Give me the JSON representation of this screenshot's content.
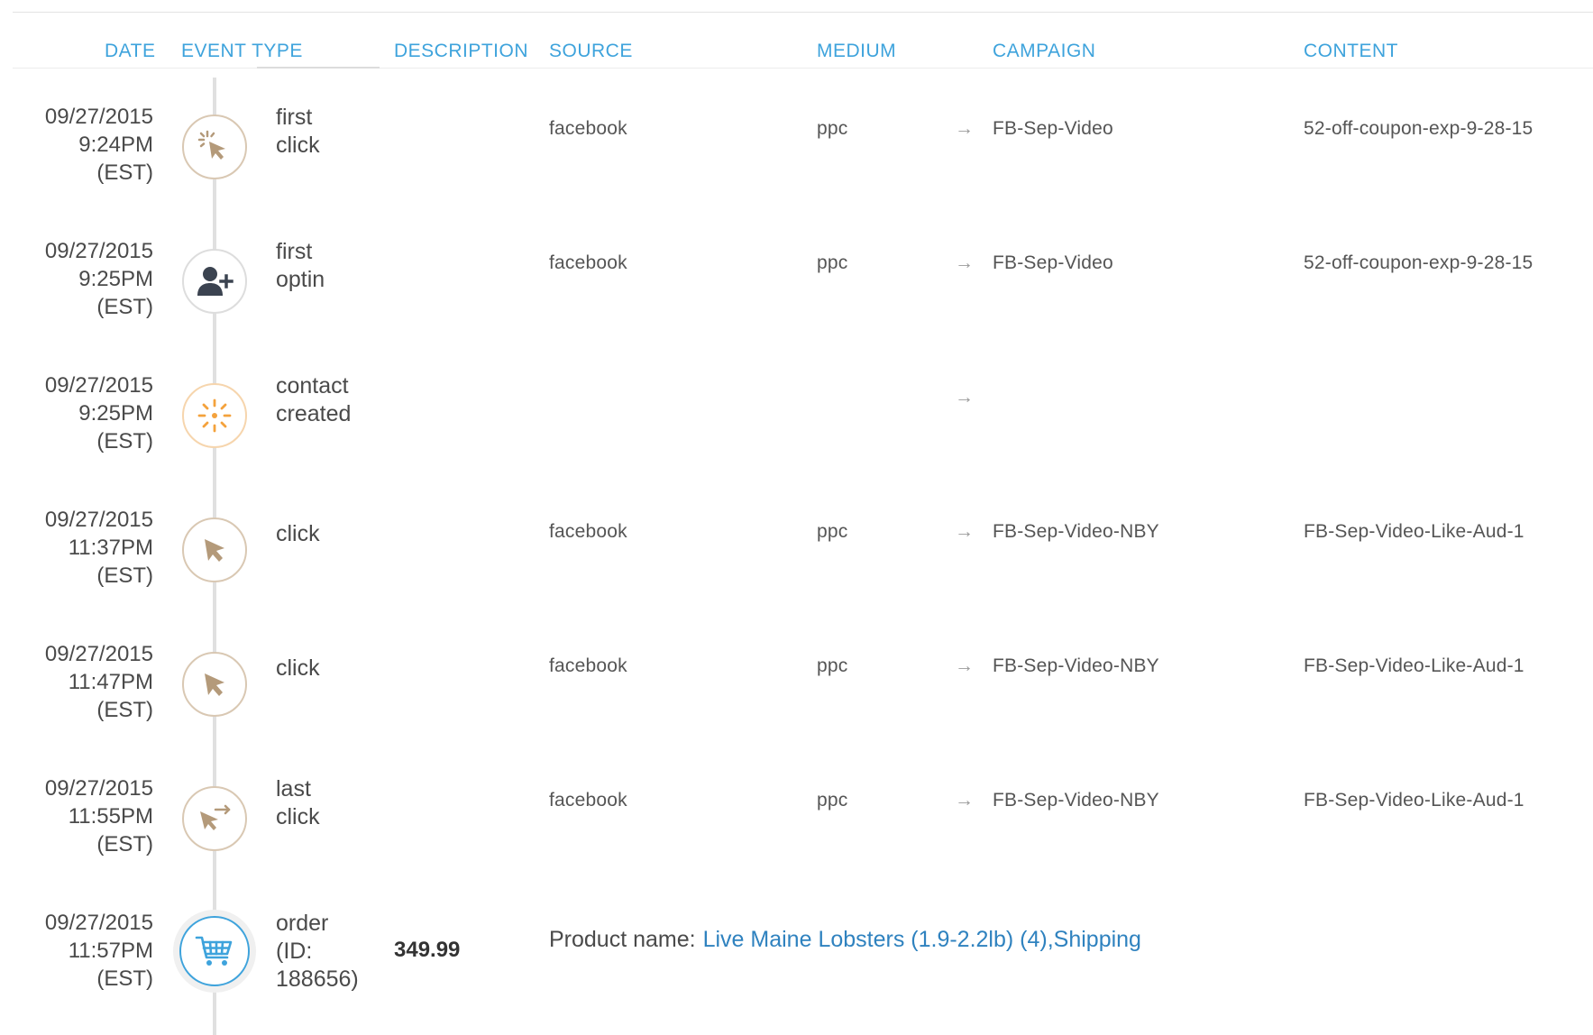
{
  "header": {
    "date": "DATE",
    "event_type": "EVENT TYPE",
    "description": "DESCRIPTION",
    "source": "SOURCE",
    "medium": "MEDIUM",
    "campaign": "CAMPAIGN",
    "content": "CONTENT"
  },
  "colors": {
    "header_text": "#3ea3dc",
    "click_icon": "#b49a7a",
    "optin_icon": "#3b4350",
    "contact_icon": "#f4a23c",
    "order_icon": "#3ea3dc",
    "link": "#2f82bf"
  },
  "rows": [
    {
      "date": "09/27/2015",
      "time": "9:24PM",
      "tz": "(EST)",
      "icon": "cursor-click-burst-icon",
      "event_line1": "first",
      "event_line2": "click",
      "source": "facebook",
      "medium": "ppc",
      "arrow": "→",
      "campaign": "FB-Sep-Video",
      "content": "52-off-coupon-exp-9-28-15"
    },
    {
      "date": "09/27/2015",
      "time": "9:25PM",
      "tz": "(EST)",
      "icon": "user-add-icon",
      "event_line1": "first",
      "event_line2": "optin",
      "source": "facebook",
      "medium": "ppc",
      "arrow": "→",
      "campaign": "FB-Sep-Video",
      "content": "52-off-coupon-exp-9-28-15"
    },
    {
      "date": "09/27/2015",
      "time": "9:25PM",
      "tz": "(EST)",
      "icon": "sparkle-burst-icon",
      "event_line1": "contact",
      "event_line2": "created",
      "source": "",
      "medium": "",
      "arrow": "→",
      "campaign": "",
      "content": ""
    },
    {
      "date": "09/27/2015",
      "time": "11:37PM",
      "tz": "(EST)",
      "icon": "cursor-icon",
      "event_line1": "click",
      "event_line2": "",
      "source": "facebook",
      "medium": "ppc",
      "arrow": "→",
      "campaign": "FB-Sep-Video-NBY",
      "content": "FB-Sep-Video-Like-Aud-1"
    },
    {
      "date": "09/27/2015",
      "time": "11:47PM",
      "tz": "(EST)",
      "icon": "cursor-icon",
      "event_line1": "click",
      "event_line2": "",
      "source": "facebook",
      "medium": "ppc",
      "arrow": "→",
      "campaign": "FB-Sep-Video-NBY",
      "content": "FB-Sep-Video-Like-Aud-1"
    },
    {
      "date": "09/27/2015",
      "time": "11:55PM",
      "tz": "(EST)",
      "icon": "cursor-swap-icon",
      "event_line1": "last",
      "event_line2": "click",
      "source": "facebook",
      "medium": "ppc",
      "arrow": "→",
      "campaign": "FB-Sep-Video-NBY",
      "content": "FB-Sep-Video-Like-Aud-1"
    }
  ],
  "order_row": {
    "date": "09/27/2015",
    "time": "11:57PM",
    "tz": "(EST)",
    "icon": "shopping-cart-icon",
    "event_line1": "order",
    "event_line2": "(ID:",
    "event_line3": "188656)",
    "description": "349.99",
    "product_label": "Product name:",
    "product_link": "Live Maine Lobsters (1.9-2.2lb) (4),Shipping"
  }
}
